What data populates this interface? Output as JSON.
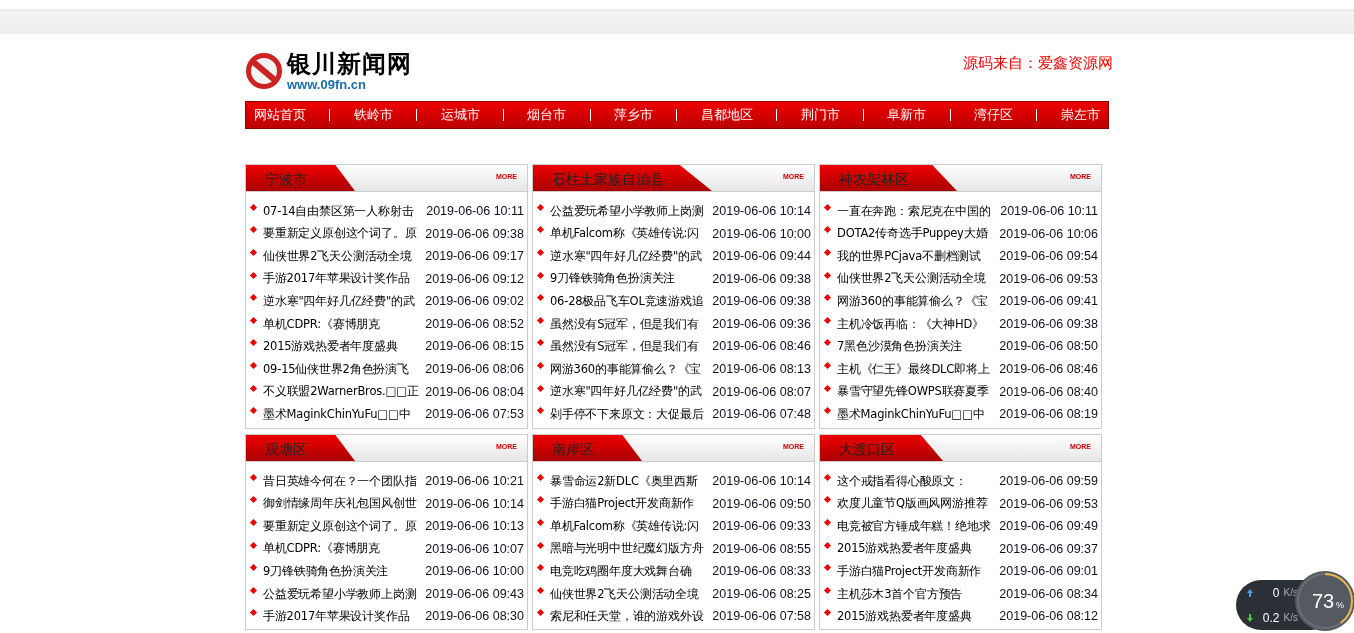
{
  "site": {
    "title": "银川新闻网",
    "url": "www.09fn.cn",
    "source_note": "源码来自：爱鑫资源网"
  },
  "nav": [
    {
      "label": "网站首页"
    },
    {
      "label": "铁岭市"
    },
    {
      "label": "运城市"
    },
    {
      "label": "烟台市"
    },
    {
      "label": "萍乡市"
    },
    {
      "label": "昌都地区"
    },
    {
      "label": "荆门市"
    },
    {
      "label": "阜新市"
    },
    {
      "label": "湾仔区"
    },
    {
      "label": "崇左市"
    }
  ],
  "panels": [
    {
      "title": "宁波市",
      "more": "MORE",
      "items": [
        {
          "title": "07-14自由禁区第一人称射击",
          "time": "2019-06-06 10:11"
        },
        {
          "title": "要重新定义原创这个词了。原",
          "time": "2019-06-06 09:38"
        },
        {
          "title": "仙侠世界2飞天公测活动全境",
          "time": "2019-06-06 09:17"
        },
        {
          "title": "手游2017年苹果设计奖作品",
          "time": "2019-06-06 09:12"
        },
        {
          "title": "逆水寒\"四年好几亿经费\"的武",
          "time": "2019-06-06 09:02"
        },
        {
          "title": "单机CDPR:《赛博朋克",
          "time": "2019-06-06 08:52"
        },
        {
          "title": "2015游戏热爱者年度盛典",
          "time": "2019-06-06 08:15"
        },
        {
          "title": "09-15仙侠世界2角色扮演飞",
          "time": "2019-06-06 08:06"
        },
        {
          "title": "不义联盟2WarnerBros.□□正",
          "time": "2019-06-06 08:04"
        },
        {
          "title": "墨术MaginkChinYuFu□□中",
          "time": "2019-06-06 07:53"
        }
      ]
    },
    {
      "title": "石柱土家族自治县",
      "more": "MORE",
      "items": [
        {
          "title": "公益爱玩希望小学教师上岗测",
          "time": "2019-06-06 10:14"
        },
        {
          "title": "单机Falcom称《英雄传说:闪",
          "time": "2019-06-06 10:00"
        },
        {
          "title": "逆水寒\"四年好几亿经费\"的武",
          "time": "2019-06-06 09:44"
        },
        {
          "title": "9刀锋铁骑角色扮演关注",
          "time": "2019-06-06 09:38"
        },
        {
          "title": "06-28极品飞车OL竞速游戏追",
          "time": "2019-06-06 09:38"
        },
        {
          "title": "虽然没有S冠军，但是我们有",
          "time": "2019-06-06 09:36"
        },
        {
          "title": "虽然没有S冠军，但是我们有",
          "time": "2019-06-06 08:46"
        },
        {
          "title": "网游360的事能算偷么？《宝",
          "time": "2019-06-06 08:13"
        },
        {
          "title": "逆水寒\"四年好几亿经费\"的武",
          "time": "2019-06-06 08:07"
        },
        {
          "title": "剁手停不下来原文：大促最后",
          "time": "2019-06-06 07:48"
        }
      ]
    },
    {
      "title": "神农架林区",
      "more": "MORE",
      "items": [
        {
          "title": "一直在奔跑：索尼克在中国的",
          "time": "2019-06-06 10:11"
        },
        {
          "title": "DOTA2传奇选手Puppey大婚",
          "time": "2019-06-06 10:06"
        },
        {
          "title": "我的世界PCjava不删档测试",
          "time": "2019-06-06 09:54"
        },
        {
          "title": "仙侠世界2飞天公测活动全境",
          "time": "2019-06-06 09:53"
        },
        {
          "title": "网游360的事能算偷么？《宝",
          "time": "2019-06-06 09:41"
        },
        {
          "title": "主机冷饭再临：《大神HD》",
          "time": "2019-06-06 09:38"
        },
        {
          "title": "7黑色沙漠角色扮演关注",
          "time": "2019-06-06 08:50"
        },
        {
          "title": "主机《仁王》最终DLC即将上",
          "time": "2019-06-06 08:46"
        },
        {
          "title": "暴雪守望先锋OWPS联赛夏季",
          "time": "2019-06-06 08:40"
        },
        {
          "title": "墨术MaginkChinYuFu□□中",
          "time": "2019-06-06 08:19"
        }
      ]
    },
    {
      "title": "观塘区",
      "more": "MORE",
      "items": [
        {
          "title": "昔日英雄今何在？一个团队指",
          "time": "2019-06-06 10:21"
        },
        {
          "title": "御剑情缘周年庆礼包国风创世",
          "time": "2019-06-06 10:14"
        },
        {
          "title": "要重新定义原创这个词了。原",
          "time": "2019-06-06 10:13"
        },
        {
          "title": "单机CDPR:《赛博朋克",
          "time": "2019-06-06 10:07"
        },
        {
          "title": "9刀锋铁骑角色扮演关注",
          "time": "2019-06-06 10:00"
        },
        {
          "title": "公益爱玩希望小学教师上岗测",
          "time": "2019-06-06 09:43"
        },
        {
          "title": "手游2017年苹果设计奖作品",
          "time": "2019-06-06 08:30"
        }
      ]
    },
    {
      "title": "南岸区",
      "more": "MORE",
      "items": [
        {
          "title": "暴雪命运2新DLC《奥里西斯",
          "time": "2019-06-06 10:14"
        },
        {
          "title": "手游白猫Project开发商新作",
          "time": "2019-06-06 09:50"
        },
        {
          "title": "单机Falcom称《英雄传说:闪",
          "time": "2019-06-06 09:33"
        },
        {
          "title": "黑暗与光明中世纪魔幻版方舟",
          "time": "2019-06-06 08:55"
        },
        {
          "title": "电竞吃鸡圈年度大戏舞台确",
          "time": "2019-06-06 08:33"
        },
        {
          "title": "仙侠世界2飞天公测活动全境",
          "time": "2019-06-06 08:25"
        },
        {
          "title": "索尼和任天堂，谁的游戏外设",
          "time": "2019-06-06 07:58"
        }
      ]
    },
    {
      "title": "大渡口区",
      "more": "MORE",
      "items": [
        {
          "title": "这个戒指看得心酸原文：",
          "time": "2019-06-06 09:59"
        },
        {
          "title": "欢度儿童节Q版画风网游推荐",
          "time": "2019-06-06 09:53"
        },
        {
          "title": "电竞被官方锤成年糕！绝地求",
          "time": "2019-06-06 09:49"
        },
        {
          "title": "2015游戏热爱者年度盛典",
          "time": "2019-06-06 09:37"
        },
        {
          "title": "手游白猫Project开发商新作",
          "time": "2019-06-06 09:01"
        },
        {
          "title": "主机莎木3首个官方预告",
          "time": "2019-06-06 08:34"
        },
        {
          "title": "2015游戏热爱者年度盛典",
          "time": "2019-06-06 08:12"
        }
      ]
    }
  ],
  "net_widget": {
    "upload": "0",
    "upload_unit": "K/s",
    "download": "0.2",
    "download_unit": "K/s",
    "memory": "73",
    "memory_unit": "%"
  }
}
